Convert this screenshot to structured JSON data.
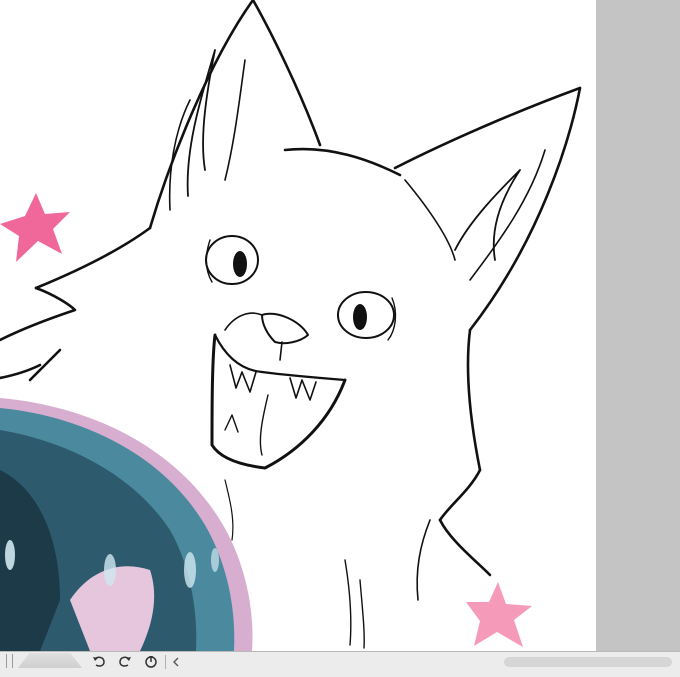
{
  "canvas": {
    "background": "#ffffff",
    "workspace_background": "#c4c4c4",
    "artwork": {
      "subject": "line-art-fox",
      "line_color": "#111111",
      "star_color_left": "#f0689a",
      "star_color_right": "#f59ab8",
      "hair_colors": [
        "#2e5a6e",
        "#4b8a9e",
        "#e2b4d6"
      ]
    }
  },
  "toolbar": {
    "icons": [
      "undo-icon",
      "redo-icon",
      "rotate-reset-icon",
      "chevron-left-icon"
    ]
  }
}
